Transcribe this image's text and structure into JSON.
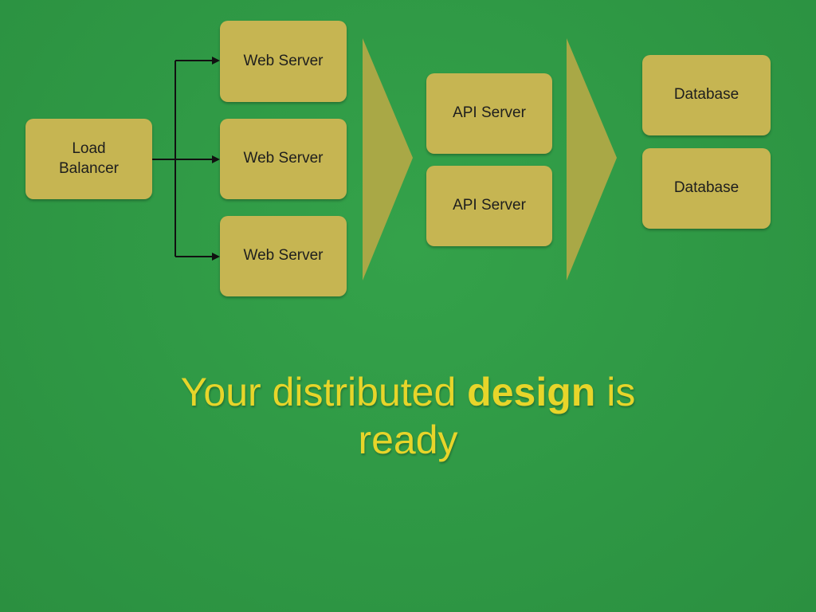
{
  "diagram": {
    "load_balancer": {
      "label": "Load\nBalancer"
    },
    "web_servers": [
      {
        "label": "Web Server"
      },
      {
        "label": "Web Server"
      },
      {
        "label": "Web Server"
      }
    ],
    "api_servers": [
      {
        "label": "API Server"
      },
      {
        "label": "API Server"
      }
    ],
    "databases": [
      {
        "label": "Database"
      },
      {
        "label": "Database"
      }
    ]
  },
  "caption": {
    "before": "Your distributed ",
    "emphasis": "design",
    "after": " is",
    "line2": "ready"
  },
  "colors": {
    "background": "#2f9a45",
    "box": "#c6b552",
    "chevron": "#a9a846",
    "caption_text": "#e7d52a"
  }
}
